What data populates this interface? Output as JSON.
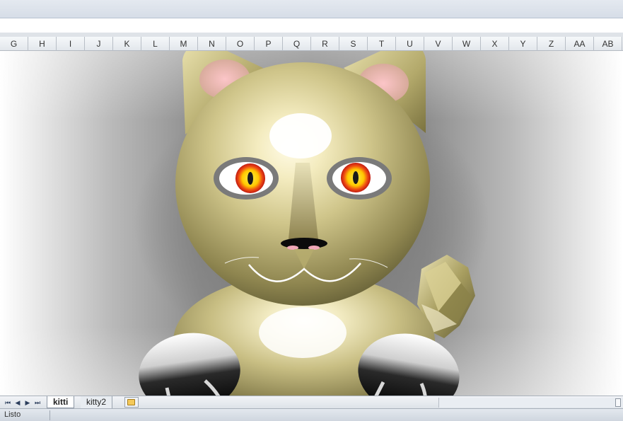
{
  "columns": [
    "G",
    "H",
    "I",
    "J",
    "K",
    "L",
    "M",
    "N",
    "O",
    "P",
    "Q",
    "R",
    "S",
    "T",
    "U",
    "V",
    "W",
    "X",
    "Y",
    "Z",
    "AA",
    "AB"
  ],
  "sheet_tabs": [
    {
      "label": "kitti",
      "active": true
    },
    {
      "label": "kitty2",
      "active": false
    }
  ],
  "status": {
    "text": "Listo"
  },
  "icons": {
    "nav_first": "first-sheet-icon",
    "nav_prev": "prev-sheet-icon",
    "nav_next": "next-sheet-icon",
    "nav_last": "last-sheet-icon",
    "insert_sheet": "insert-sheet-icon"
  },
  "colors": {
    "kitty_body": "#b7ac6a",
    "eye_iris": "#ffd400",
    "eye_ring": "#e0201a",
    "ear_inner": "#f3b7bd"
  }
}
